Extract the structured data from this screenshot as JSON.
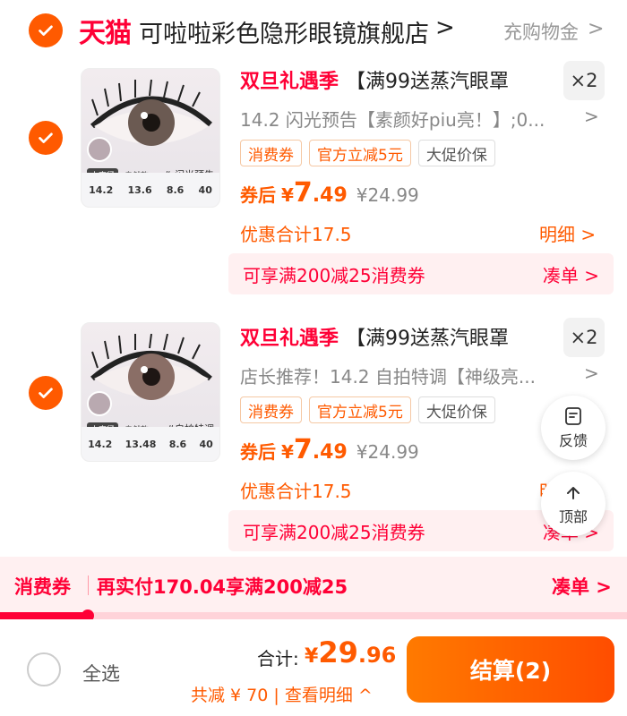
{
  "shop": {
    "brand": "天猫",
    "name": "可啦啦彩色隐形眼镜旗舰店",
    "name_arrow": ">",
    "coupon_link": "充购物金",
    "coupon_arrow": ">"
  },
  "items": [
    {
      "promo": "双旦礼遇季",
      "title": "【满99送蒸汽眼罩",
      "qty": "×2",
      "sku": "14.2 闪光预告【素颜好piu亮！】;0...",
      "sku_arrow": ">",
      "thumb_tag": "# 闪光预告",
      "thumb_size_tag": "小直径",
      "thumb_style_tag": "自然款",
      "thumb_specs": [
        "14.2",
        "13.6",
        "8.6",
        "40"
      ],
      "tags": [
        "消费券",
        "官方立减5元",
        "大促价保"
      ],
      "price_prefix": "券后",
      "price_yen": "¥",
      "price_int": "7",
      "price_dec": ".49",
      "orig_price": "¥24.99",
      "discount": "优惠合计17.5",
      "detail": "明细 >",
      "coupon_text": "可享满200减25消费券",
      "coupon_action": "凑单 >"
    },
    {
      "promo": "双旦礼遇季",
      "title": "【满99送蒸汽眼罩",
      "qty": "×2",
      "sku": "店长推荐！14.2 自拍特调【神级亮...",
      "sku_arrow": ">",
      "thumb_tag": "#自拍特调",
      "thumb_size_tag": "小直径",
      "thumb_style_tag": "自然款",
      "thumb_specs": [
        "14.2",
        "13.48",
        "8.6",
        "40"
      ],
      "tags": [
        "消费券",
        "官方立减5元",
        "大促价保"
      ],
      "price_prefix": "券后",
      "price_yen": "¥",
      "price_int": "7",
      "price_dec": ".49",
      "orig_price": "¥24.99",
      "discount": "优惠合计17.5",
      "detail": "明细 >",
      "coupon_text": "可享满200减25消费券",
      "coupon_action": "凑单 >"
    }
  ],
  "float": {
    "feedback": "反馈",
    "top": "顶部"
  },
  "strip": {
    "title": "消费券",
    "desc": "再实付170.04享满200减25",
    "action": "凑单 >",
    "progress": 0.14
  },
  "footer": {
    "select_all": "全选",
    "total_label": "合计:",
    "total_yen": "¥",
    "total_int": "29",
    "total_dec": ".96",
    "saved": "共减 ¥ 70 | 查看明细 ^",
    "checkout": "结算(2)"
  },
  "colors": {
    "accent": "#ff5a00",
    "tmall_red": "#ff0036"
  }
}
